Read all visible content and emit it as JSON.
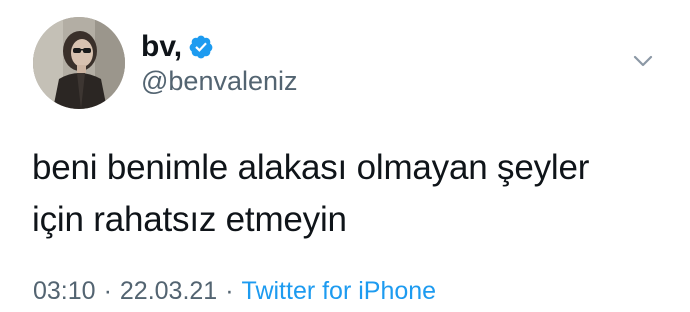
{
  "author": {
    "display_name": "bv,",
    "handle": "@benvaleniz",
    "verified": true
  },
  "tweet": {
    "text": "beni benimle alakası olmayan şeyler\niçin rahatsız etmeyin"
  },
  "meta": {
    "time": "03:10",
    "separator": "·",
    "date": "22.03.21",
    "source": "Twitter for iPhone"
  },
  "icons": {
    "verified": "verified-badge-icon",
    "caret": "chevron-down-icon"
  },
  "colors": {
    "text": "#0f1419",
    "secondary": "#536471",
    "accent": "#1d9bf0"
  }
}
